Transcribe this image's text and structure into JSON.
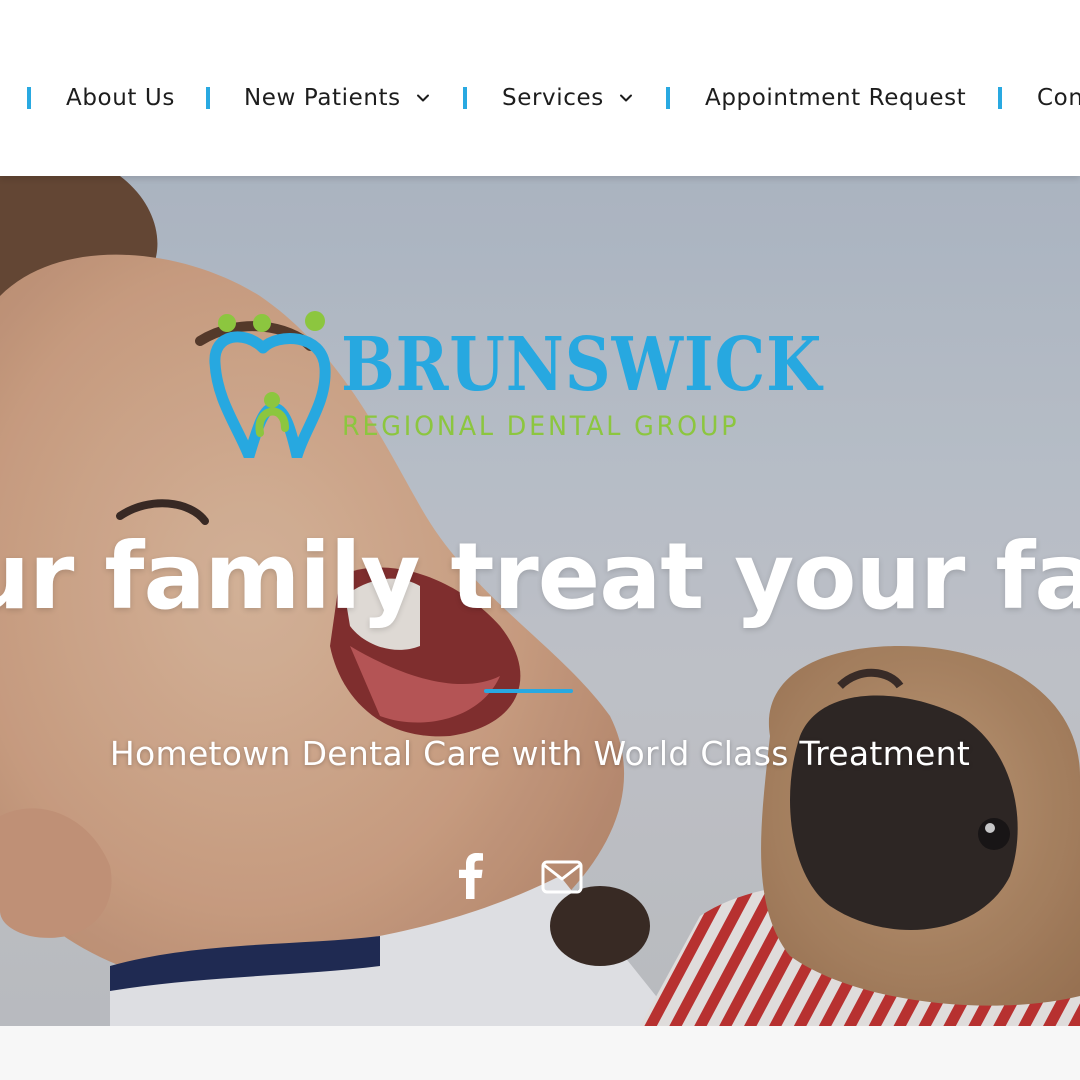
{
  "nav": {
    "items": [
      {
        "label": "About Us",
        "has_dropdown": false
      },
      {
        "label": "New Patients",
        "has_dropdown": true
      },
      {
        "label": "Services",
        "has_dropdown": true
      },
      {
        "label": "Appointment Request",
        "has_dropdown": false
      },
      {
        "label": "Con",
        "has_dropdown": false
      }
    ],
    "separator_color": "#29a9e1"
  },
  "hero": {
    "logo": {
      "name": "BRUNSWICK",
      "tagline": "REGIONAL DENTAL GROUP",
      "name_color": "#27a8e0",
      "tagline_color": "#8cc63f"
    },
    "headline": "ur family treat your fa",
    "subheadline": "Hometown Dental Care with World Class Treatment",
    "accent_color": "#29a9e1",
    "social_icons": [
      "facebook-icon",
      "envelope-icon"
    ]
  }
}
